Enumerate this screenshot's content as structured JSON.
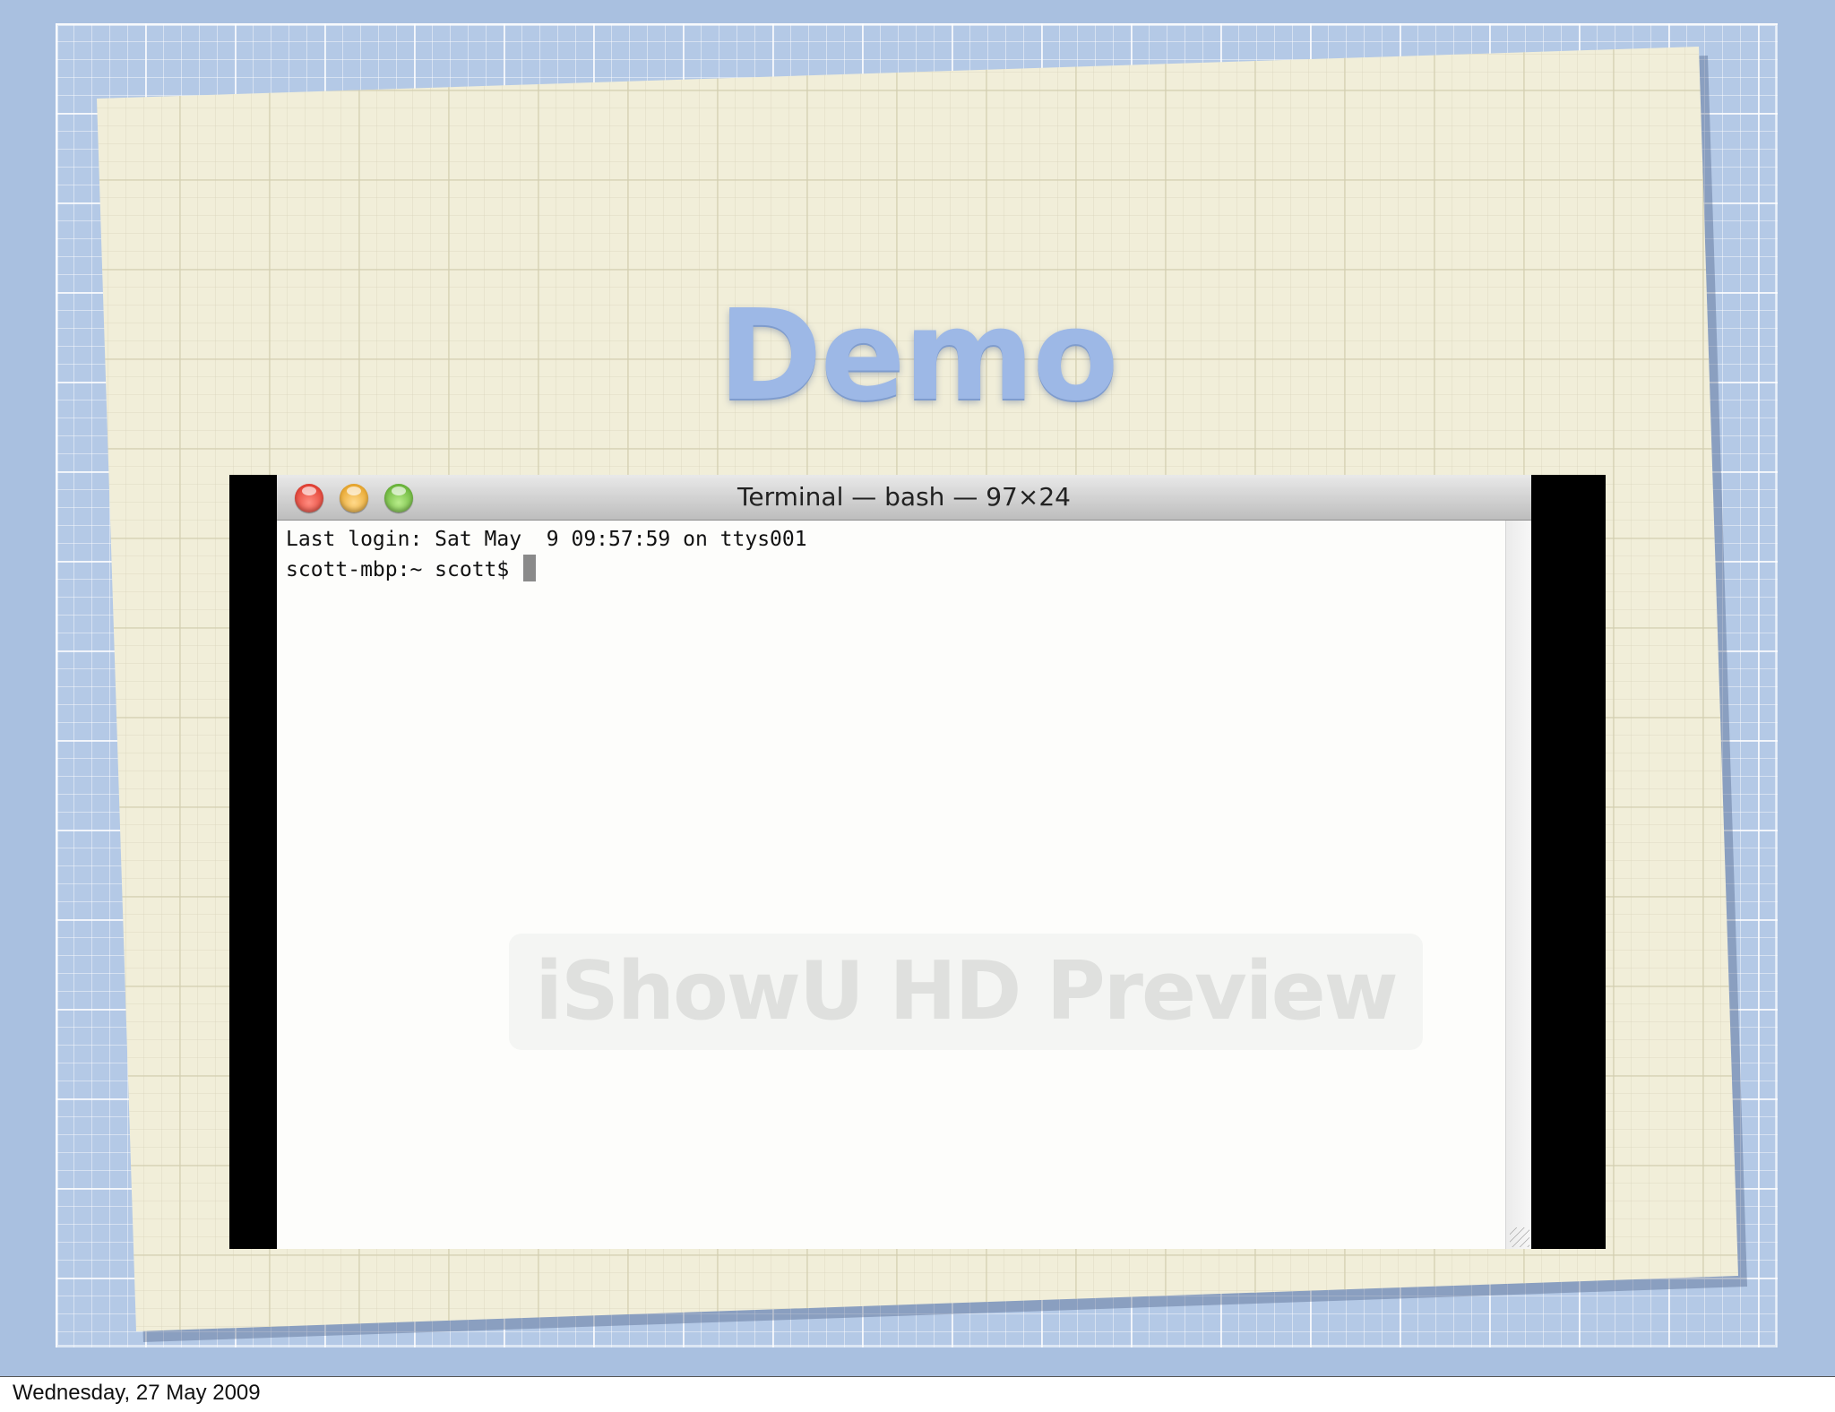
{
  "slide": {
    "title": "Demo",
    "footer_date": "Wednesday, 27 May 2009"
  },
  "terminal": {
    "window_title": "Terminal — bash — 97×24",
    "lines": [
      "Last login: Sat May  9 09:57:59 on ttys001",
      "scott-mbp:~ scott$ "
    ],
    "buttons": {
      "close": "close-button",
      "minimize": "minimize-button",
      "zoom": "zoom-button"
    }
  },
  "overlay": {
    "watermark_text": "iShowU HD Preview"
  },
  "colors": {
    "slide_background": "#a9c0e0",
    "paper": "#f1eed9",
    "title_blue": "#9db8e6",
    "close_red": "#d8261a",
    "minimize_yellow": "#e0950e",
    "zoom_green": "#4fa21f"
  }
}
